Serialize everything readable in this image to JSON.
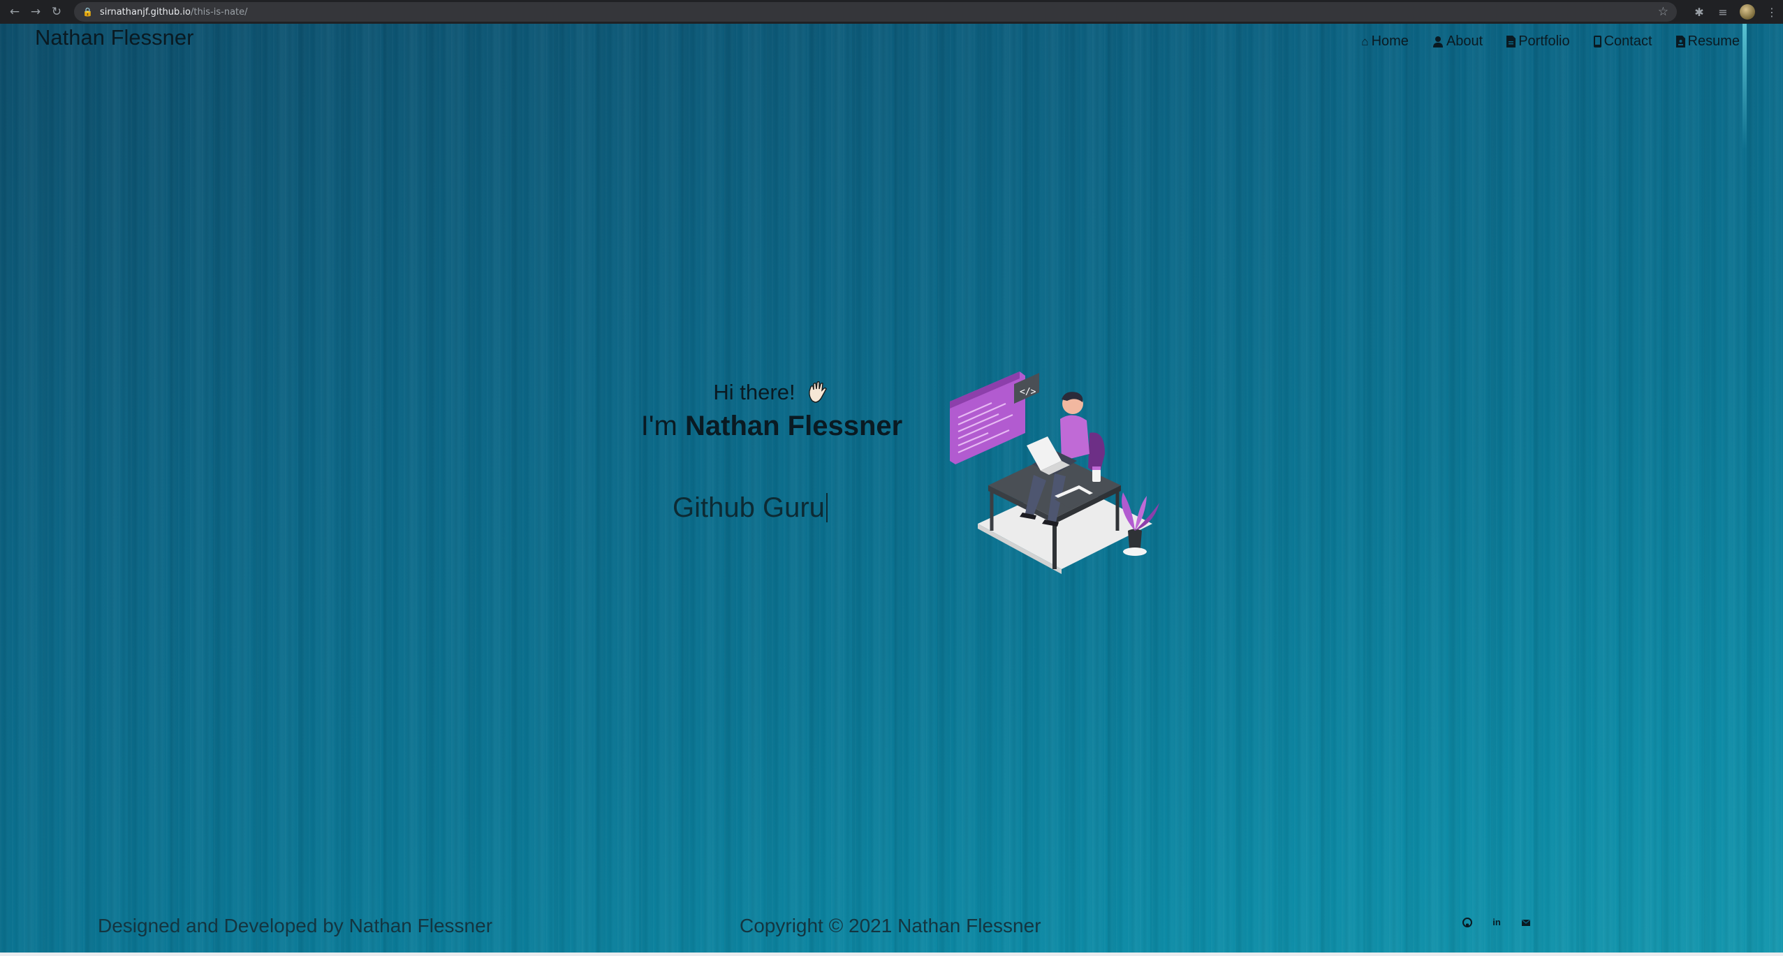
{
  "browser": {
    "url_host": "sirnathanjf.github.io",
    "url_path": "/this-is-nate/"
  },
  "site": {
    "brand": "Nathan Flessner"
  },
  "nav": {
    "items": [
      {
        "label": "Home",
        "icon": "home-icon"
      },
      {
        "label": "About",
        "icon": "user-icon"
      },
      {
        "label": "Portfolio",
        "icon": "file-icon"
      },
      {
        "label": "Contact",
        "icon": "phone-icon"
      },
      {
        "label": "Resume",
        "icon": "document-icon"
      }
    ]
  },
  "hero": {
    "greeting": "Hi there!",
    "intro_prefix": "I'm",
    "name": "Nathan Flessner",
    "typed_role": "Github Guru"
  },
  "footer": {
    "left": "Designed and Developed by Nathan Flessner",
    "center": "Copyright © 2021 Nathan Flessner",
    "social": [
      {
        "icon": "github-icon"
      },
      {
        "icon": "linkedin-icon",
        "glyph": "in"
      },
      {
        "icon": "mail-icon"
      }
    ]
  },
  "colors": {
    "background_teal": "#0b6585",
    "text_dark": "#0a1a22",
    "illustration_purple": "#b25bd0"
  }
}
